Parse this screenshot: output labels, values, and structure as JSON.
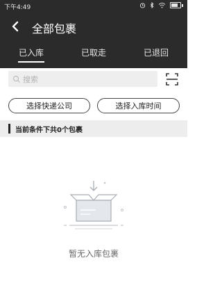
{
  "status_bar": {
    "time": "下午4:49"
  },
  "header": {
    "title": "全部包裹"
  },
  "tabs": [
    {
      "label": "已入库",
      "active": true
    },
    {
      "label": "已取走",
      "active": false
    },
    {
      "label": "已退回",
      "active": false
    }
  ],
  "search": {
    "placeholder": "搜索"
  },
  "filters": {
    "courier_label": "选择快递公司",
    "time_label": "选择入库时间"
  },
  "condition": {
    "text": "当前条件下共0个包裹"
  },
  "empty_state": {
    "text": "暂无入库包裹"
  },
  "colors": {
    "header_bg": "#2b2b2b",
    "condition_bg": "#ededed",
    "accent": "#ffffff"
  },
  "icons": {
    "back": "back-arrow-icon",
    "search": "search-icon",
    "scan": "scan-icon"
  }
}
